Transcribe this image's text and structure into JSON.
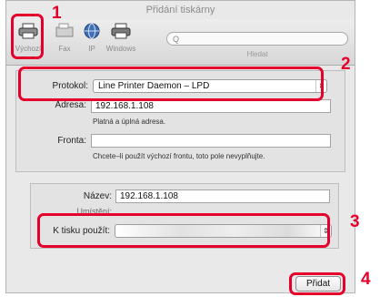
{
  "window": {
    "title": "Přidání tiskárny"
  },
  "toolbar": {
    "items": [
      {
        "label": "Výchozí",
        "icon": "printer-icon"
      },
      {
        "label": "Fax",
        "icon": "fax-icon"
      },
      {
        "label": "IP",
        "icon": "globe-icon"
      },
      {
        "label": "Windows",
        "icon": "printer-icon"
      }
    ],
    "search_placeholder": "Q",
    "search_label": "Hledat"
  },
  "form": {
    "protocol_label": "Protokol:",
    "protocol_value": "Line Printer Daemon – LPD",
    "address_label": "Adresa:",
    "address_value": "192.168.1.108",
    "address_hint": "Platná a úplná adresa.",
    "queue_label": "Fronta:",
    "queue_value": "",
    "queue_hint": "Chcete–li použít výchozí frontu, toto pole nevyplňujte.",
    "name_label": "Název:",
    "name_value": "192.168.1.108",
    "location_label": "Umístění:",
    "use_label": "K tisku použít:",
    "use_value": ""
  },
  "buttons": {
    "add": "Přidat"
  },
  "callouts": [
    "1",
    "2",
    "3",
    "4"
  ],
  "colors": {
    "highlight": "#e4002b"
  }
}
